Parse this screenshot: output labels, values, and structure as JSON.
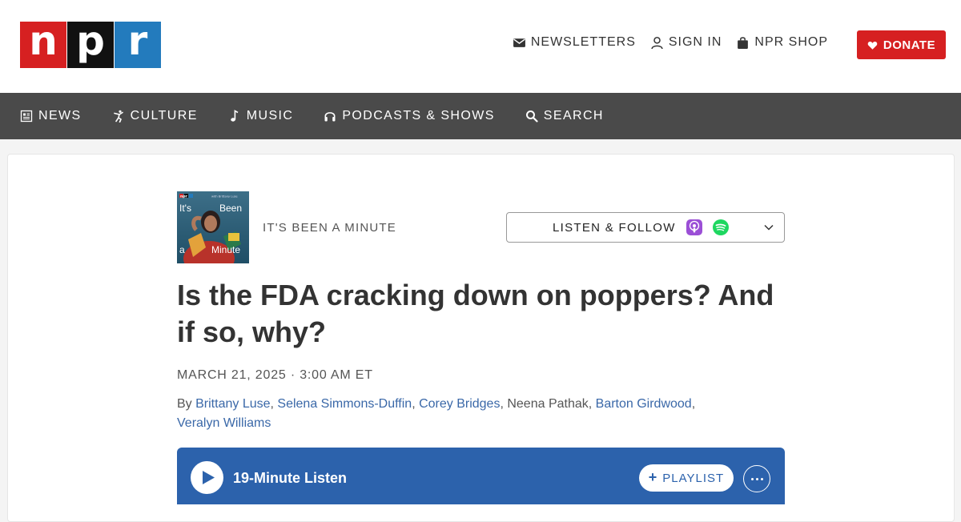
{
  "header": {
    "logo": {
      "letters": [
        "n",
        "p",
        "r"
      ]
    },
    "links": [
      {
        "label": "NEWSLETTERS",
        "icon": "envelope-icon"
      },
      {
        "label": "SIGN IN",
        "icon": "user-icon"
      },
      {
        "label": "NPR SHOP",
        "icon": "shopping-bag-icon"
      }
    ],
    "donate_label": "DONATE"
  },
  "nav": [
    {
      "label": "NEWS",
      "icon": "newspaper-icon"
    },
    {
      "label": "CULTURE",
      "icon": "dancer-icon"
    },
    {
      "label": "MUSIC",
      "icon": "music-note-icon"
    },
    {
      "label": "PODCASTS & SHOWS",
      "icon": "headphones-icon"
    },
    {
      "label": "SEARCH",
      "icon": "search-icon"
    }
  ],
  "show": {
    "name": "IT'S BEEN A MINUTE",
    "thumb_text": {
      "brand": "npr",
      "host": "with Brittany Luse",
      "w1": "It's",
      "w2": "Been",
      "w3": "a",
      "w4": "Minute"
    }
  },
  "listen_follow": {
    "label": "LISTEN & FOLLOW",
    "icons": [
      "apple-podcasts-icon",
      "spotify-icon",
      "chevron-down-icon"
    ]
  },
  "article": {
    "headline": "Is the FDA cracking down on poppers? And if so, why?",
    "date": "MARCH 21, 2025 · 3:00 AM ET",
    "by_prefix": "By",
    "authors": [
      {
        "name": "Brittany Luse",
        "linked": true
      },
      {
        "name": "Selena Simmons-Duffin",
        "linked": true
      },
      {
        "name": "Corey Bridges",
        "linked": true
      },
      {
        "name": "Neena Pathak",
        "linked": false
      },
      {
        "name": "Barton Girdwood",
        "linked": true
      },
      {
        "name": "Veralyn Williams",
        "linked": true
      }
    ]
  },
  "player": {
    "duration_label": "19-Minute Listen",
    "playlist_label": "PLAYLIST"
  },
  "colors": {
    "npr_red": "#d62021",
    "npr_black": "#111111",
    "npr_blue": "#237bbd",
    "nav_bg": "#4a4a4a",
    "player_blue": "#2c62ac",
    "link_blue": "#3a68a8"
  }
}
